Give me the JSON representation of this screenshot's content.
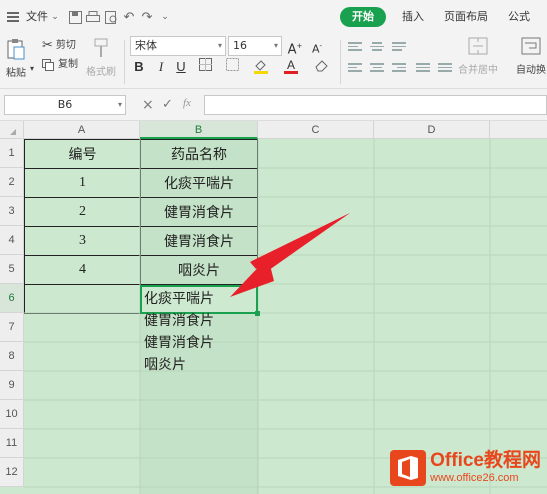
{
  "menubar": {
    "file_label": "文件",
    "tabs": [
      {
        "label": "开始",
        "active": true
      },
      {
        "label": "插入",
        "active": false
      },
      {
        "label": "页面布局",
        "active": false
      },
      {
        "label": "公式",
        "active": false
      }
    ]
  },
  "ribbon": {
    "paste_label": "粘贴",
    "cut_label": "剪切",
    "copy_label": "复制",
    "format_painter_label": "格式刷",
    "font_name": "宋体",
    "font_size": "16",
    "merge_center_label": "合并居中",
    "wrap_label": "自动换",
    "font_color": "#e02020",
    "fill_color": "#f5d800",
    "icons": [
      "paste-icon",
      "scissors-icon",
      "copy-icon",
      "format-painter-icon",
      "bold-icon",
      "italic-icon",
      "underline-icon",
      "border-icon",
      "fill-color-icon",
      "font-color-icon",
      "clear-icon",
      "merge-icon",
      "wrap-icon"
    ]
  },
  "formula_bar": {
    "name_box": "B6",
    "cancel_icon": "×",
    "confirm_icon": "✓",
    "fx_icon": "fx",
    "content": ""
  },
  "sheet": {
    "columns": [
      "A",
      "B",
      "C",
      "D"
    ],
    "rows": [
      "1",
      "2",
      "3",
      "4",
      "5",
      "6",
      "7",
      "8",
      "9",
      "10",
      "11",
      "12"
    ],
    "header": {
      "a": "编号",
      "b": "药品名称"
    },
    "data_rows": [
      {
        "a": "1",
        "b": "化痰平喘片"
      },
      {
        "a": "2",
        "b": "健胃消食片"
      },
      {
        "a": "3",
        "b": "健胃消食片"
      },
      {
        "a": "4",
        "b": "咽炎片"
      }
    ],
    "b6_lines": [
      "化痰平喘片",
      "健胃消食片",
      "健胃消食片",
      "咽炎片"
    ],
    "selected_cell": "B6",
    "selection_color": "#1aa14f",
    "sheet_bg": "#cce8cf"
  },
  "watermark": {
    "title": "Office教程网",
    "url": "www.office26.com",
    "brand_color": "#e8471d"
  },
  "annotation": {
    "arrow_color": "#e8202a"
  }
}
